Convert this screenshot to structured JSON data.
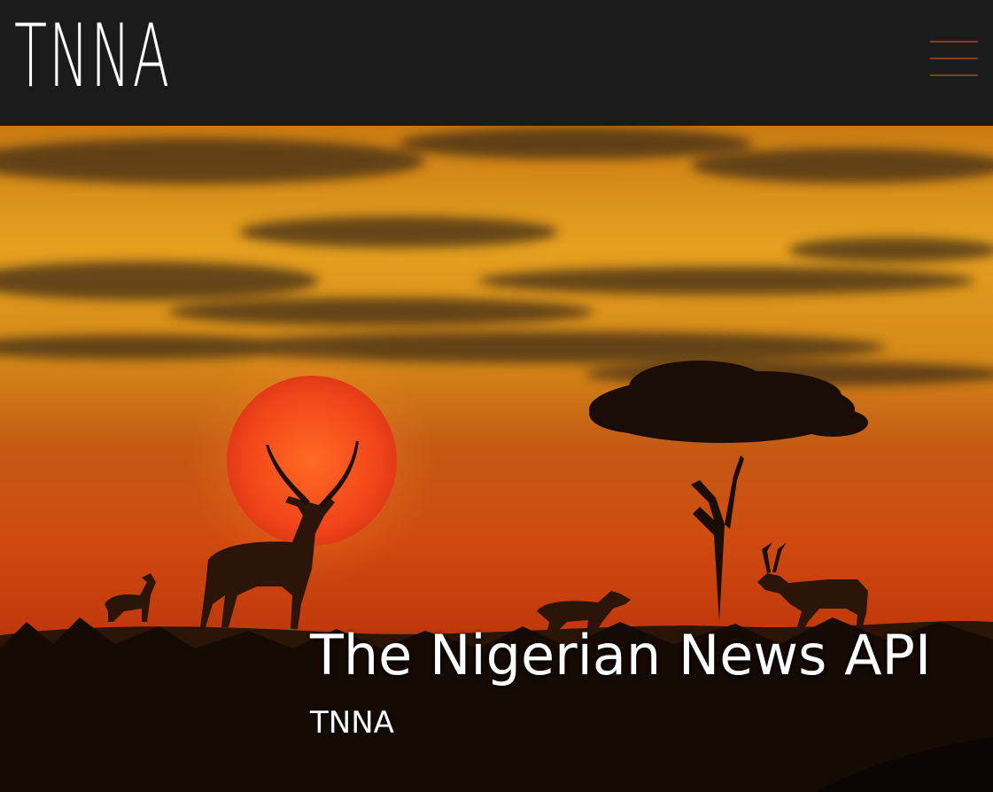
{
  "header": {
    "logo_text": "TNNA",
    "menu_icon": "hamburger-menu-icon"
  },
  "hero": {
    "title": "The Nigerian News API",
    "subtitle": "TNNA",
    "image": "savanna-sunset-with-impala-and-acacia-tree"
  },
  "colors": {
    "header_bg": "#1b1b1b",
    "menu_accent": "#8a3a14",
    "text": "#ffffff"
  }
}
